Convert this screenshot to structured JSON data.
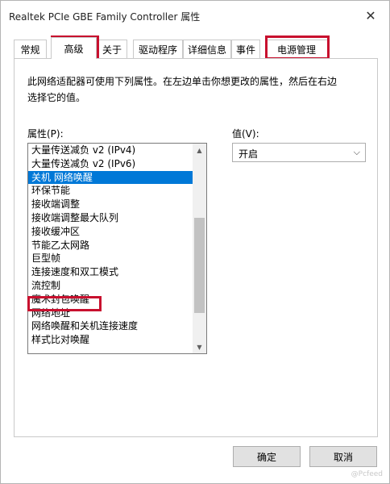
{
  "window": {
    "title": "Realtek PCIe GBE Family Controller 属性",
    "close_glyph": "✕"
  },
  "tabs": [
    "常规",
    "高级",
    "关于",
    "驱动程序",
    "详细信息",
    "事件",
    "电源管理"
  ],
  "active_tab": "高级",
  "highlight_color": "#c8102e",
  "description": "此网络适配器可使用下列属性。在左边单击你想更改的属性，然后在右边选择它的值。",
  "property_label": "属性(P):",
  "value_label": "值(V):",
  "properties": [
    "大量传送减负 v2 (IPv4)",
    "大量传送减负 v2 (IPv6)",
    "关机 网络唤醒",
    "环保节能",
    "接收端调整",
    "接收端调整最大队列",
    "接收缓冲区",
    "节能乙太网路",
    "巨型帧",
    "连接速度和双工模式",
    "流控制",
    "魔术封包唤醒",
    "网络地址",
    "网络唤醒和关机连接速度",
    "样式比对唤醒"
  ],
  "selected_property": "关机 网络唤醒",
  "highlighted_property": "魔术封包唤醒",
  "selection_color": "#0078d7",
  "value": {
    "selected": "开启"
  },
  "buttons": {
    "ok": "确定",
    "cancel": "取消"
  },
  "watermark": "@Pcfeed"
}
